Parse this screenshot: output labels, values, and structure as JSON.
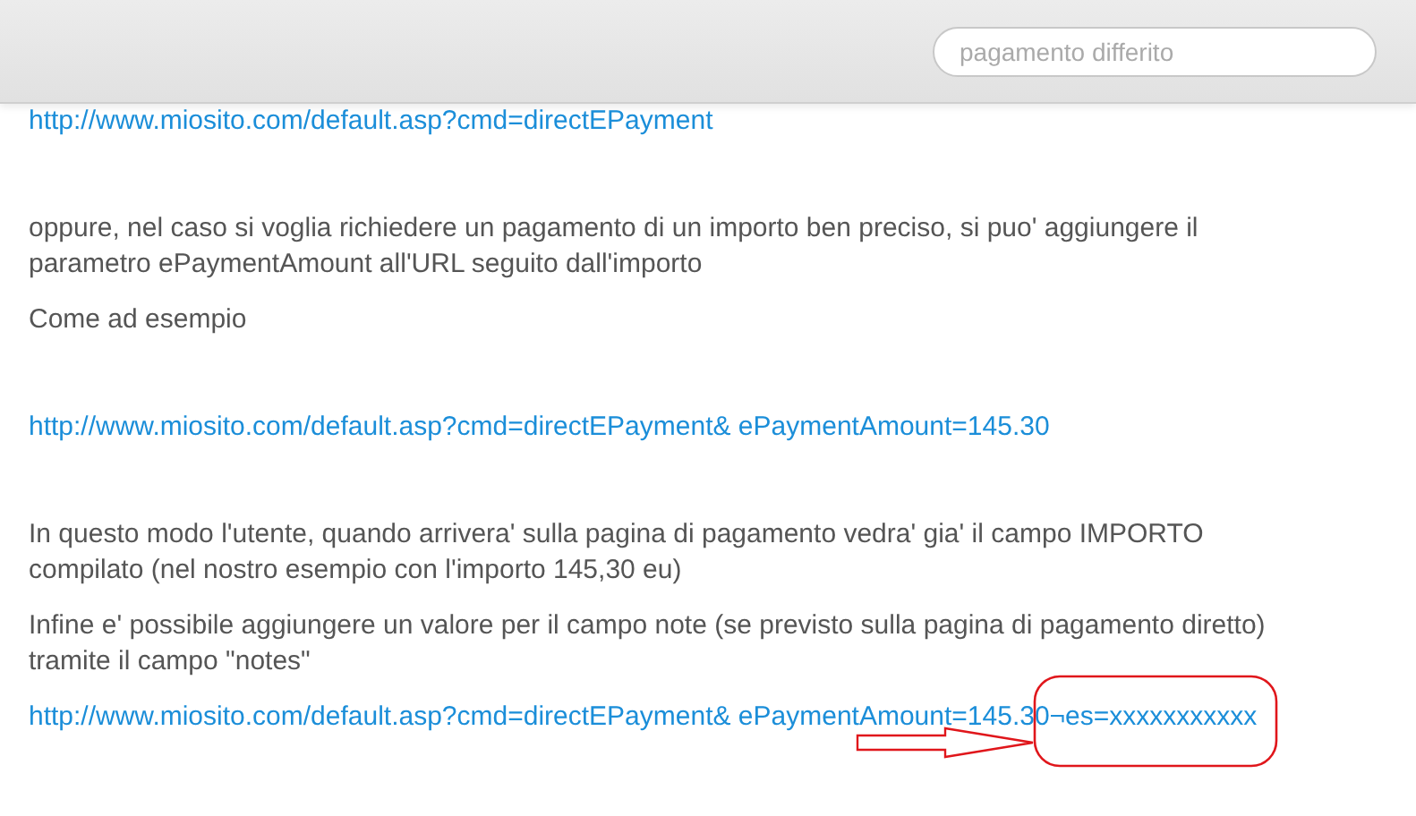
{
  "header": {
    "search": {
      "placeholder": "pagamento differito"
    }
  },
  "sections": [
    [
      {
        "kind": "link",
        "text": "http://www.miosito.com/default.asp?cmd=directEPayment"
      }
    ],
    [
      {
        "kind": "text",
        "text": "oppure, nel caso si voglia richiedere un pagamento di un importo ben preciso, si puo' aggiungere il parametro ePaymentAmount all'URL seguito dall'importo"
      },
      {
        "kind": "text",
        "text": "Come ad esempio"
      }
    ],
    [
      {
        "kind": "link",
        "text": "http://www.miosito.com/default.asp?cmd=directEPayment& ePaymentAmount=145.30"
      }
    ],
    [
      {
        "kind": "text",
        "text": "In questo modo l'utente, quando arrivera' sulla pagina di pagamento vedra' gia' il campo IMPORTO compilato (nel nostro esempio con l'importo 145,30 eu)"
      },
      {
        "kind": "text",
        "text": "Infine e' possibile aggiungere un valore per il campo note (se previsto sulla pagina di pagamento diretto) tramite il campo \"notes\""
      },
      {
        "kind": "link",
        "text": "http://www.miosito.com/default.asp?cmd=directEPayment& ePaymentAmount=145.30¬es=xxxxxxxxxxx"
      }
    ]
  ]
}
